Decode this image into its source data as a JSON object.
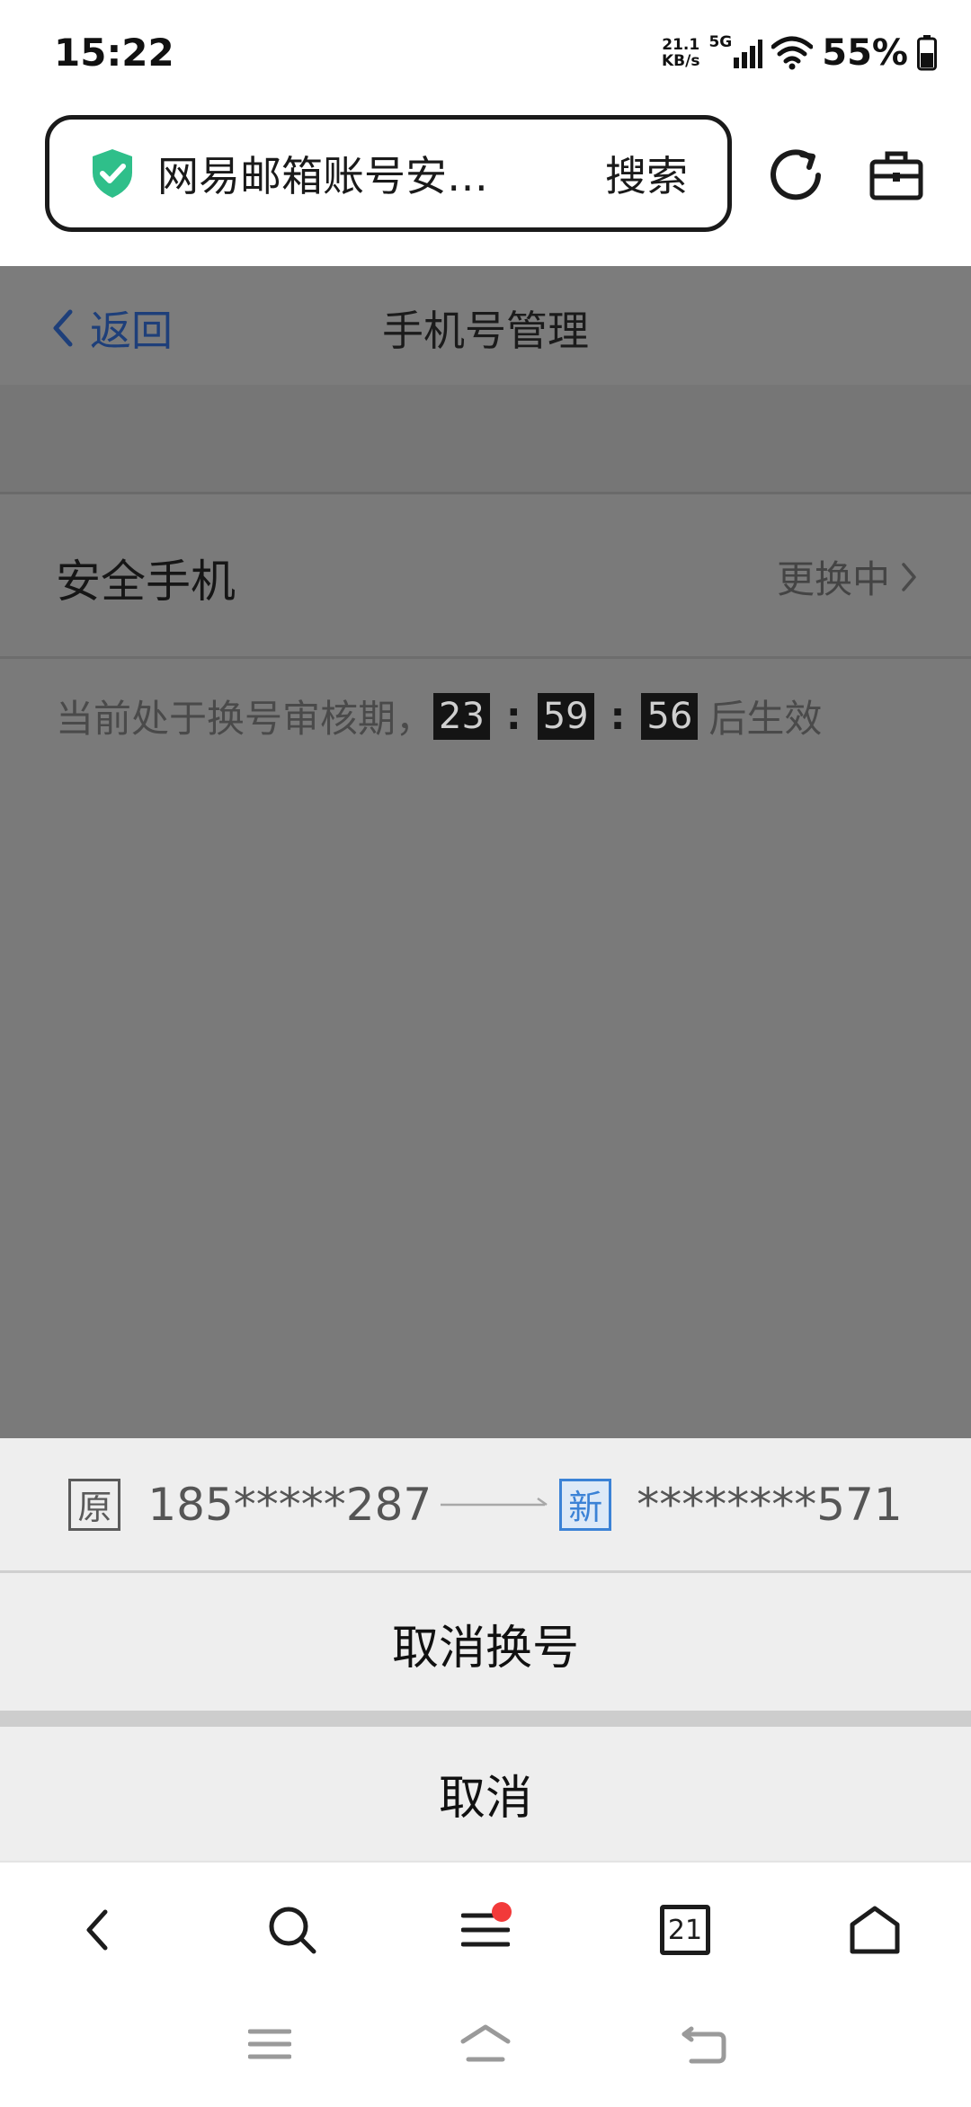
{
  "status_bar": {
    "time": "15:22",
    "net_speed_value": "21.1",
    "net_speed_unit": "KB/s",
    "network_type": "5G",
    "battery": "55%"
  },
  "browser": {
    "url_text": "网易邮箱账号安…",
    "search_label": "搜索"
  },
  "page": {
    "back_label": "返回",
    "title": "手机号管理",
    "phone_label": "安全手机",
    "phone_status": "更换中",
    "notice_prefix": "当前处于换号审核期，",
    "countdown": {
      "hours": "23",
      "minutes": "59",
      "seconds": "56"
    },
    "countdown_separator": ":",
    "notice_suffix": "后生效"
  },
  "sheet": {
    "old_tag": "原",
    "old_number": "185*****287",
    "new_tag": "新",
    "new_number": "********571",
    "cancel_change_label": "取消换号",
    "cancel_label": "取消"
  },
  "toolbar": {
    "tab_count": "21"
  },
  "colors": {
    "overlay_gray": "#7a7a7a",
    "link_blue": "#1e3f7a",
    "new_tag_blue": "#3b82d6",
    "shield_green": "#2fbf8a",
    "badge_red": "#f23a3a"
  }
}
